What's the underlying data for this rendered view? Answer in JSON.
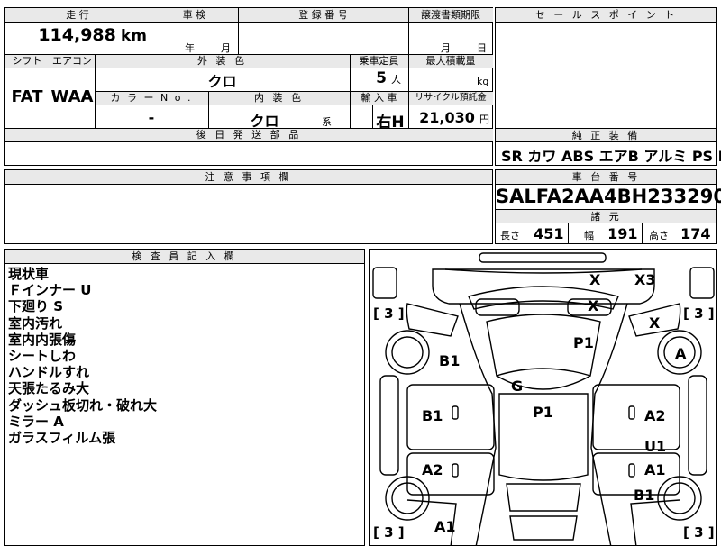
{
  "top": {
    "mileage_header": "走 行",
    "mileage_value": "114,988",
    "mileage_unit": "km",
    "inspection_header": "車 検",
    "inspection_year_unit": "年",
    "inspection_month_unit": "月",
    "reg_header": "登 録 番 号",
    "transfer_header": "譲渡書類期限",
    "transfer_month_unit": "月",
    "transfer_day_unit": "日"
  },
  "sales_point_header": "セ ー ル ス ポ イ ン ト",
  "row2": {
    "shift_header": "シフト",
    "shift_value": "FAT",
    "ac_header": "エアコン",
    "ac_value": "WAA",
    "exterior_header": "外 装 色",
    "exterior_value": "クロ",
    "capacity_header": "乗車定員",
    "capacity_value": "5",
    "capacity_unit": "人",
    "maxload_header": "最大積載量",
    "maxload_unit": "kg",
    "color_no_header": "カ ラ ー N o .",
    "color_no_value": "-",
    "interior_header": "内 装 色",
    "interior_value": "クロ",
    "interior_suffix": "系",
    "import_header": "輸 入 車",
    "import_value": "右H",
    "recycle_header": "リサイクル預託金",
    "recycle_value": "21,030",
    "recycle_unit": "円"
  },
  "later_parts_header": "後 日 発 送 部 品",
  "genuine_header": "純 正 装 備",
  "genuine_items": "SR カワ ABS エアB アルミ PS PW",
  "notes_header": "注 意 事 項 欄",
  "chassis_header": "車 台 番 号",
  "chassis_value": "SALFA2AA4BH233290",
  "specs_header": "諸 元",
  "specs": {
    "length_label": "長さ",
    "length_value": "451",
    "width_label": "幅",
    "width_value": "191",
    "height_label": "高さ",
    "height_value": "174"
  },
  "inspector_header": "検 査 員 記 入 欄",
  "inspector_notes": [
    "現状車",
    "Ｆインナー U",
    "下廻り S",
    "室内汚れ",
    "室内内張傷",
    "シートしわ",
    "ハンドルすれ",
    "天張たるみ大",
    "ダッシュ板切れ・破れ大",
    "ミラー A",
    "ガラスフィルム張"
  ],
  "diagram": {
    "brackets": [
      "[ 3 ]",
      "[ 3 ]",
      "[ 3 ]",
      "[ 3 ]"
    ],
    "marks": {
      "m1": "X",
      "m2": "X3",
      "m3": "X",
      "m4": "X",
      "m5": "P1",
      "m6": "A",
      "m7": "B1",
      "m8": "G",
      "m9": "P1",
      "m10": "B1",
      "m11": "A2",
      "m12": "U1",
      "m13": "A2",
      "m14": "A1",
      "m15": "B1",
      "m16": "A1"
    }
  }
}
